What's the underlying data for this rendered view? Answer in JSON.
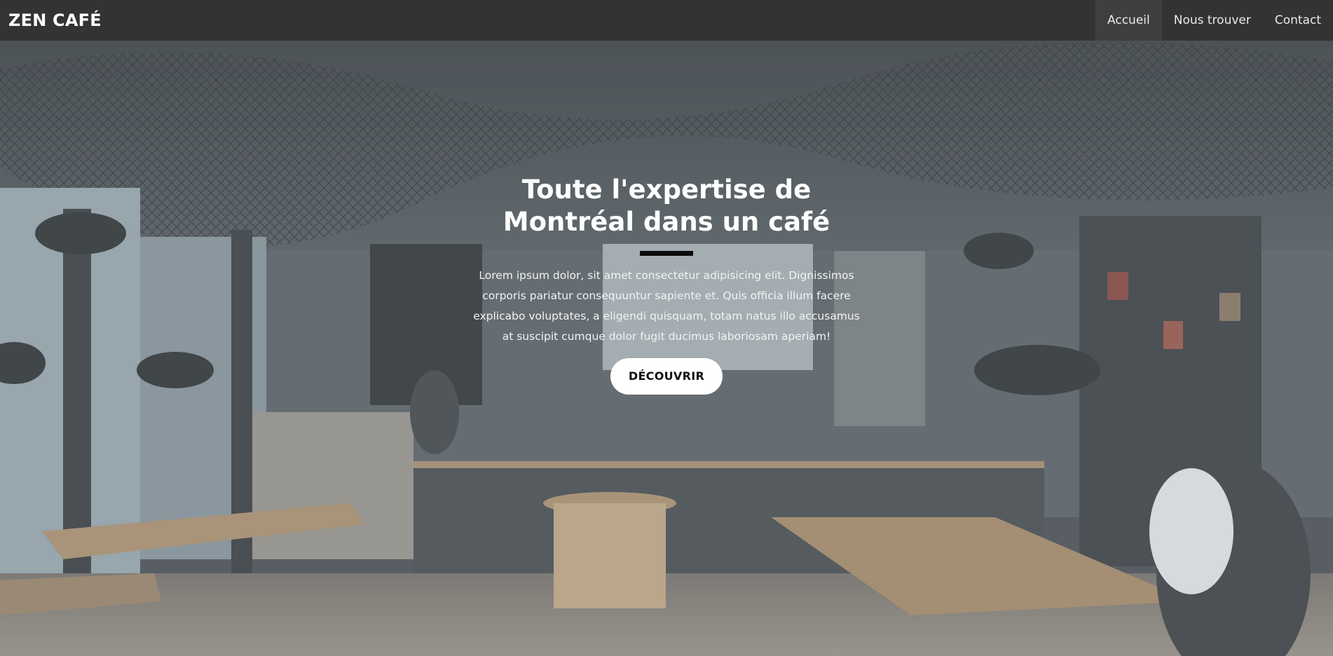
{
  "brand": "ZEN CAFÉ",
  "nav": {
    "items": [
      "Accueil",
      "Nous trouver",
      "Contact"
    ],
    "active": "Accueil"
  },
  "hero": {
    "title": "Toute l'expertise de Montréal dans un café",
    "text": "Lorem ipsum dolor, sit amet consectetur adipisicing elit. Dignissimos corporis pariatur consequuntur sapiente et. Quis officia illum facere explicabo voluptates, a eligendi quisquam, totam natus illo accusamus at suscipit cumque dolor fugit ducimus laboriosam aperiam!",
    "button": "DÉCOUVRIR",
    "underline_color": "#0b0b0b"
  },
  "colors": {
    "navbar_bg": "#333333",
    "navbar_active_bg": "#3f3f3f",
    "button_bg": "#ffffff"
  }
}
